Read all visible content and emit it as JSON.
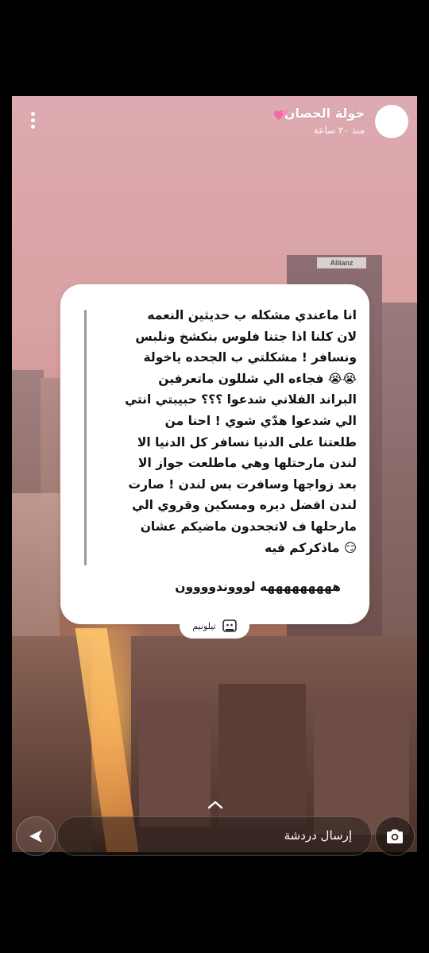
{
  "header": {
    "user_name": "خولة الحصان",
    "timestamp": "منذ ٢٠ ساعة",
    "billboard": "Allianz"
  },
  "card": {
    "lines": [
      "انا ماعندي مشكله ب حديثين النعمه",
      "لان كلنا اذا جتنا فلوس بنكشخ ونلبس",
      "ونسافر ! مشكلتي ب الجحده ياخولة",
      "😭😭 فجاءه الي شللون ماتعرفين",
      "البراند الفلاني شدعوا ؟؟؟ حبيبتي انتي",
      "الي شدعوا هدّي شوي ! احنا من",
      "طلعتنا على الدنيا نسافر كل الدنيا الا",
      "لندن مارحتلها وهي ماطلعت جواز الا",
      "بعد زواجها وسافرت بس لندن ! صارت",
      "لندن افضل ديره ومسكين وقروي الي",
      "مارحلها ف لاتجحدون ماضيكم عشان",
      "😏 ماذكركم فيه"
    ],
    "reply": "هههههههههه لوووندوووون",
    "source_label": "تيلونيم"
  },
  "footer": {
    "chat_placeholder": "إرسال دردشة"
  }
}
